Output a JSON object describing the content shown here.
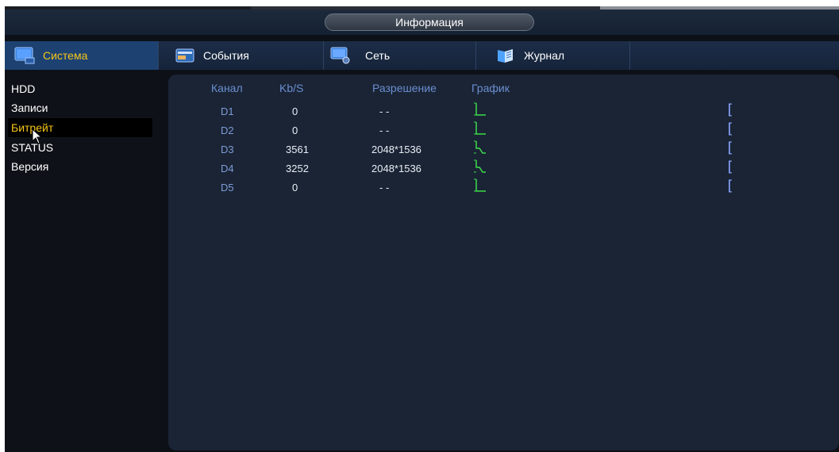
{
  "window": {
    "title": "Информация"
  },
  "tabs": [
    {
      "label": "Система",
      "icon": "monitor-icon",
      "active": true
    },
    {
      "label": "События",
      "icon": "events-icon",
      "active": false
    },
    {
      "label": "Сеть",
      "icon": "network-icon",
      "active": false
    },
    {
      "label": "Журнал",
      "icon": "log-icon",
      "active": false
    }
  ],
  "sidebar": {
    "items": [
      {
        "label": "HDD",
        "active": false
      },
      {
        "label": "Записи",
        "active": false
      },
      {
        "label": "Битрейт",
        "active": true
      },
      {
        "label": "STATUS",
        "active": false
      },
      {
        "label": "Версия",
        "active": false
      }
    ]
  },
  "bitrate_table": {
    "headers": {
      "channel": "Канал",
      "kbps": "Kb/S",
      "resolution": "Разрешение",
      "graph": "График"
    },
    "rows": [
      {
        "channel": "D1",
        "kbps": "0",
        "resolution": "- -",
        "graph": "flat"
      },
      {
        "channel": "D2",
        "kbps": "0",
        "resolution": "- -",
        "graph": "flat"
      },
      {
        "channel": "D3",
        "kbps": "3561",
        "resolution": "2048*1536",
        "graph": "active"
      },
      {
        "channel": "D4",
        "kbps": "3252",
        "resolution": "2048*1536",
        "graph": "active"
      },
      {
        "channel": "D5",
        "kbps": "0",
        "resolution": "- -",
        "graph": "flat"
      }
    ],
    "row_end_marker": "["
  },
  "colors": {
    "accent_yellow": "#f5c518",
    "header_blue": "#6b8ed0",
    "graph_green": "#3ddc4a",
    "panel": "#1a2435"
  }
}
